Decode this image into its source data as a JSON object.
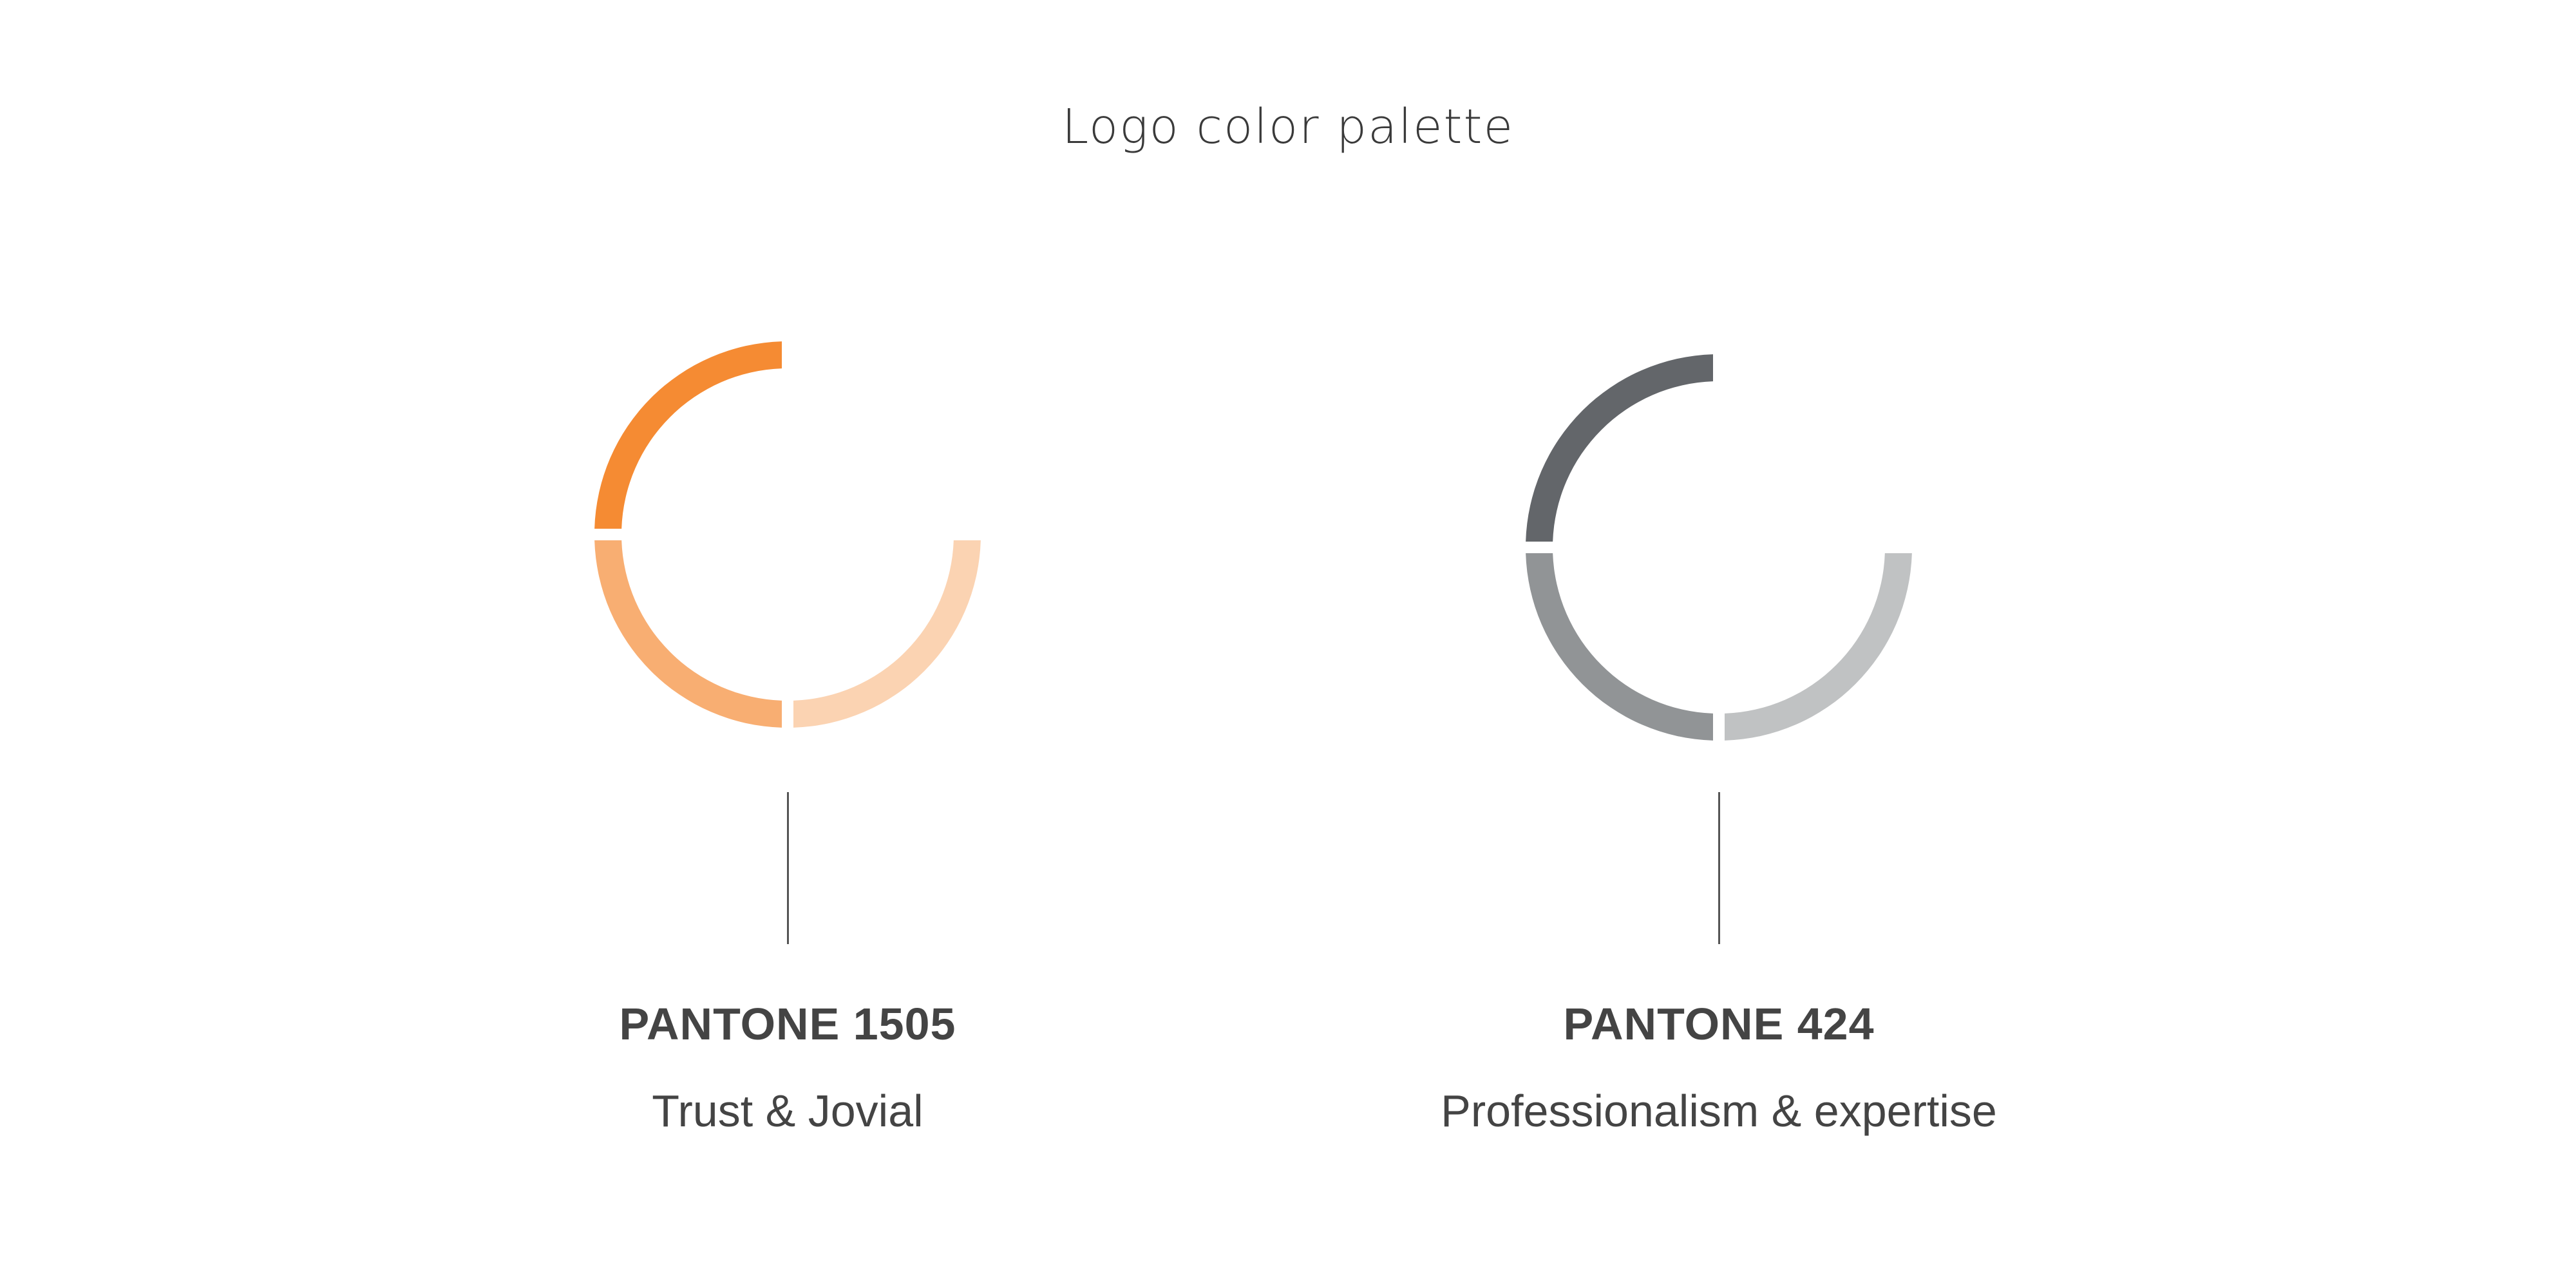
{
  "title": "Logo color palette",
  "palettes": [
    {
      "pantone": "PANTONE 1505",
      "description": "Trust & Jovial",
      "colors": {
        "primary": "#F58B33",
        "secondary": "#F8AE72",
        "tertiary": "#FBD3B2"
      }
    },
    {
      "pantone": "PANTONE 424",
      "description": "Professionalism & expertise",
      "colors": {
        "primary": "#63666A",
        "secondary": "#919496",
        "tertiary": "#C0C2C3"
      }
    }
  ]
}
